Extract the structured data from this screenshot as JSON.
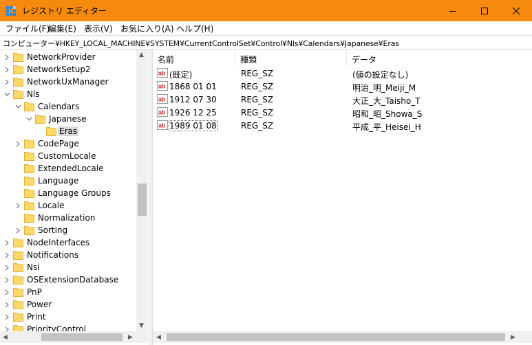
{
  "window": {
    "title": "レジストリ エディター",
    "accent_color": "#f58a0e",
    "minimize_icon": "minimize-icon",
    "maximize_icon": "maximize-icon",
    "close_icon": "close-icon"
  },
  "menu": {
    "items": [
      "ファイル(F)",
      "編集(E)",
      "表示(V)",
      "お気に入り(A)",
      "ヘルプ(H)"
    ]
  },
  "address": {
    "path": "コンピューター¥HKEY_LOCAL_MACHINE¥SYSTEM¥CurrentControlSet¥Control¥Nls¥Calendars¥Japanese¥Eras"
  },
  "tree": {
    "items": [
      {
        "label": "NetworkProvider",
        "expander": "collapsed"
      },
      {
        "label": "NetworkSetup2",
        "expander": "collapsed"
      },
      {
        "label": "NetworkUxManager",
        "expander": "collapsed"
      },
      {
        "label": "Nls",
        "expander": "expanded"
      },
      {
        "label": "Calendars",
        "expander": "expanded"
      },
      {
        "label": "Japanese",
        "expander": "expanded"
      },
      {
        "label": "Eras",
        "expander": "none",
        "selected": true
      },
      {
        "label": "CodePage",
        "expander": "collapsed"
      },
      {
        "label": "CustomLocale",
        "expander": "none"
      },
      {
        "label": "ExtendedLocale",
        "expander": "none"
      },
      {
        "label": "Language",
        "expander": "none"
      },
      {
        "label": "Language Groups",
        "expander": "none"
      },
      {
        "label": "Locale",
        "expander": "collapsed"
      },
      {
        "label": "Normalization",
        "expander": "none"
      },
      {
        "label": "Sorting",
        "expander": "collapsed"
      },
      {
        "label": "NodeInterfaces",
        "expander": "collapsed"
      },
      {
        "label": "Notifications",
        "expander": "collapsed"
      },
      {
        "label": "Nsi",
        "expander": "collapsed"
      },
      {
        "label": "OSExtensionDatabase",
        "expander": "collapsed"
      },
      {
        "label": "PnP",
        "expander": "collapsed"
      },
      {
        "label": "Power",
        "expander": "collapsed"
      },
      {
        "label": "Print",
        "expander": "collapsed"
      },
      {
        "label": "PriorityControl",
        "expander": "collapsed"
      }
    ]
  },
  "list": {
    "headers": [
      "名前",
      "種類",
      "データ"
    ],
    "rows": [
      {
        "name": "(既定)",
        "type": "REG_SZ",
        "data": "(値の設定なし)"
      },
      {
        "name": "1868 01 01",
        "type": "REG_SZ",
        "data": "明治_明_Meiji_M"
      },
      {
        "name": "1912 07 30",
        "type": "REG_SZ",
        "data": "大正_大_Taisho_T"
      },
      {
        "name": "1926 12 25",
        "type": "REG_SZ",
        "data": "昭和_昭_Showa_S"
      },
      {
        "name": "1989 01 08",
        "type": "REG_SZ",
        "data": "平成_平_Heisei_H",
        "focused": true
      }
    ]
  }
}
